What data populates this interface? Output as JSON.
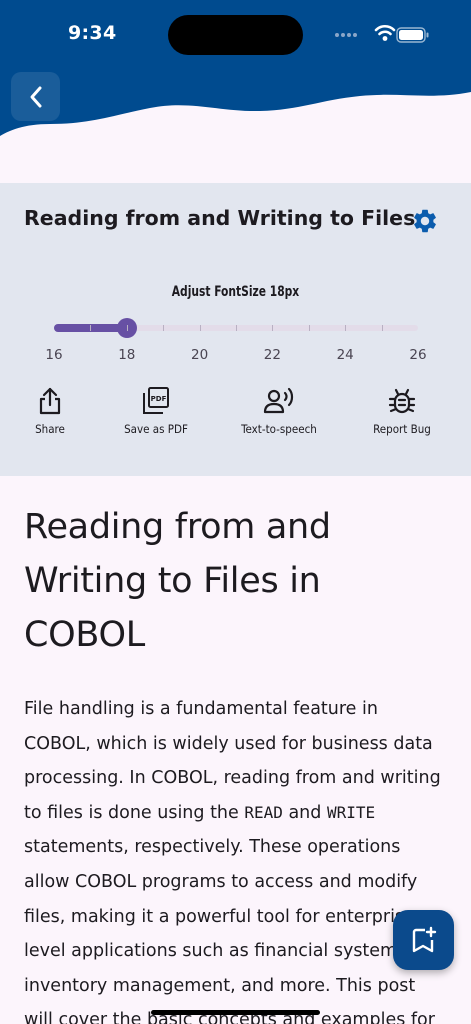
{
  "status_bar": {
    "time": "9:34"
  },
  "colors": {
    "header": "#004b8f",
    "accent": "#6750a4",
    "panel": "#e2e6ef",
    "fab": "#0b4a8c",
    "background": "#fcf5fc"
  },
  "panel": {
    "title": "Reading from and Writing to Files",
    "font_label": "Adjust FontSize 18px",
    "slider": {
      "min": 16,
      "max": 26,
      "value": 18,
      "tick_labels": [
        "16",
        "18",
        "20",
        "22",
        "24",
        "26"
      ]
    },
    "actions": [
      {
        "label": "Share",
        "icon": "share-icon"
      },
      {
        "label": "Save as PDF",
        "icon": "pdf-icon"
      },
      {
        "label": "Text-to-speech",
        "icon": "speaker-icon"
      },
      {
        "label": "Report Bug",
        "icon": "bug-icon"
      }
    ]
  },
  "article": {
    "title": "Reading from and Writing to Files in COBOL",
    "body": {
      "p1": "File handling is a fundamental feature in COBOL, which is widely used for business data processing. In COBOL, reading from and writing to files is done using the ",
      "code1": "READ",
      "and": " and ",
      "code2": "WRITE",
      "p2": " statements, respectively. These operations allow COBOL programs to access and modify files, making it a powerful tool for enterprise-level applications such as financial systems, inventory management, and more. This post will cover the basic concepts and examples for"
    }
  },
  "fab": {
    "icon": "bookmark-add-icon"
  }
}
